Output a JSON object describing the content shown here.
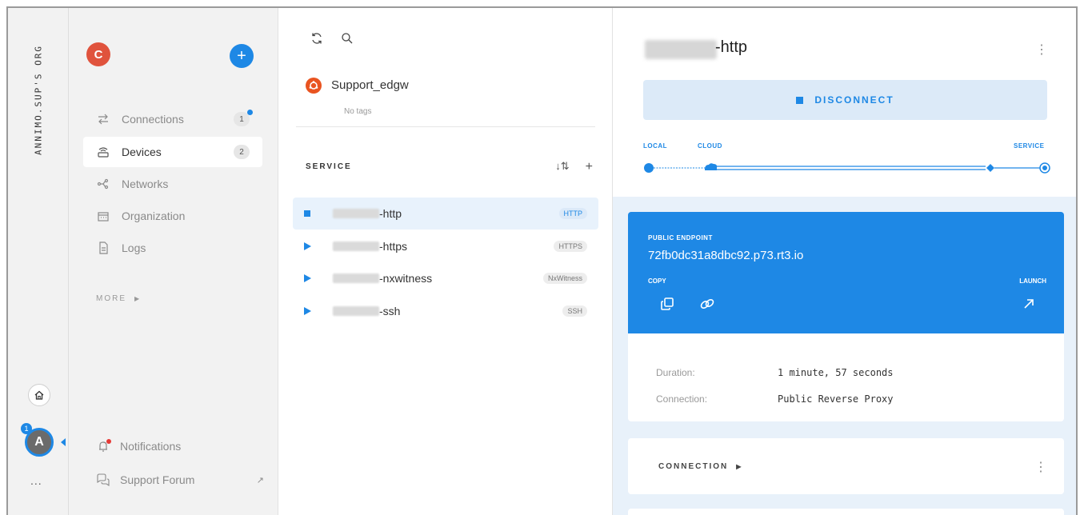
{
  "rail": {
    "org_name": "ANNIMO.SUP'S ORG",
    "user_initial": "A",
    "user_badge": "1",
    "more": "..."
  },
  "nav": {
    "org_initial": "C",
    "add_label": "+",
    "items": [
      {
        "label": "Connections",
        "count": "1",
        "icon": "connections-icon",
        "dot": true
      },
      {
        "label": "Devices",
        "count": "2",
        "icon": "devices-icon",
        "active": true
      },
      {
        "label": "Networks",
        "icon": "networks-icon"
      },
      {
        "label": "Organization",
        "icon": "organization-icon"
      },
      {
        "label": "Logs",
        "icon": "logs-icon"
      }
    ],
    "more_label": "MORE",
    "notifications_label": "Notifications",
    "support_label": "Support Forum"
  },
  "device": {
    "name": "Support_edgw",
    "tags": "No tags",
    "service_header": "SERVICE",
    "services": [
      {
        "suffix": "-http",
        "type": "HTTP",
        "state": "connected"
      },
      {
        "suffix": "-https",
        "type": "HTTPS",
        "state": "play"
      },
      {
        "suffix": "-nxwitness",
        "type": "NxWitness",
        "state": "play"
      },
      {
        "suffix": "-ssh",
        "type": "SSH",
        "state": "play"
      }
    ]
  },
  "detail": {
    "title_suffix": "-http",
    "disconnect_label": "DISCONNECT",
    "path": {
      "local": "LOCAL",
      "cloud": "CLOUD",
      "service": "SERVICE"
    },
    "endpoint": {
      "label": "PUBLIC ENDPOINT",
      "url": "72fb0dc31a8dbc92.p73.rt3.io",
      "copy_label": "COPY",
      "launch_label": "LAUNCH"
    },
    "duration_label": "Duration:",
    "duration_value": "1 minute, 57 seconds",
    "connection_label": "Connection:",
    "connection_value": "Public Reverse Proxy",
    "connection_section": "CONNECTION"
  },
  "colors": {
    "accent": "#1e88e5",
    "org_avatar": "#e0533d",
    "ubuntu": "#e95420",
    "detail_bg": "#e8f1fa"
  }
}
